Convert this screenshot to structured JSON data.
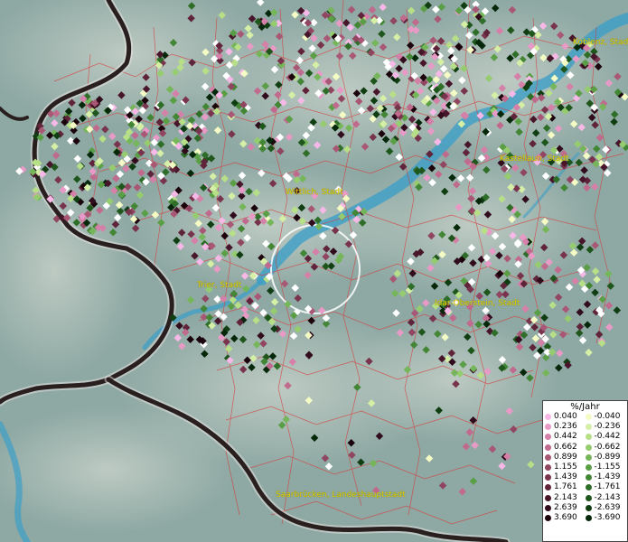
{
  "map": {
    "cities": [
      {
        "id": "koblenz",
        "label": "Koblenz, Stadt"
      },
      {
        "id": "kastellaun",
        "label": "Kastellaun, Stadt"
      },
      {
        "id": "wittlich",
        "label": "Wittlich, Stadt"
      },
      {
        "id": "trier",
        "label": "Trier, Stadt"
      },
      {
        "id": "idar",
        "label": "Idar-Oberstein, Stadt"
      },
      {
        "id": "saarbruecken",
        "label": "Saarbrücken, Landeshauptstadt"
      }
    ],
    "colors": {
      "land": "#8fa9a4",
      "hillshade_light": "#b9c8c0",
      "river": "#3d9fc7",
      "border": "#2a1f1f",
      "municipal_lines": "#d83a3a",
      "label": "#e0d000"
    }
  },
  "legend": {
    "title": "%/Jahr",
    "positive": [
      {
        "value": "0.040",
        "color": "#f6b8e6"
      },
      {
        "value": "0.236",
        "color": "#e89ac6"
      },
      {
        "value": "0.442",
        "color": "#d580a8"
      },
      {
        "value": "0.662",
        "color": "#c06a8e"
      },
      {
        "value": "0.899",
        "color": "#a85874"
      },
      {
        "value": "1.155",
        "color": "#904660"
      },
      {
        "value": "1.439",
        "color": "#78344c"
      },
      {
        "value": "1.761",
        "color": "#60243a"
      },
      {
        "value": "2.143",
        "color": "#48162a"
      },
      {
        "value": "2.639",
        "color": "#300c1c"
      },
      {
        "value": "3.690",
        "color": "#1c040c"
      }
    ],
    "negative": [
      {
        "value": "-0.040",
        "color": "#f4fbc4"
      },
      {
        "value": "-0.236",
        "color": "#d6efa6"
      },
      {
        "value": "-0.442",
        "color": "#b6df88"
      },
      {
        "value": "-0.662",
        "color": "#96cc70"
      },
      {
        "value": "-0.899",
        "color": "#76b65a"
      },
      {
        "value": "-1.155",
        "color": "#5a9e46"
      },
      {
        "value": "-1.439",
        "color": "#428636"
      },
      {
        "value": "-1.761",
        "color": "#2e6e28"
      },
      {
        "value": "-2.143",
        "color": "#1e561c"
      },
      {
        "value": "-2.639",
        "color": "#103e12"
      },
      {
        "value": "-3.690",
        "color": "#06280a"
      }
    ]
  }
}
